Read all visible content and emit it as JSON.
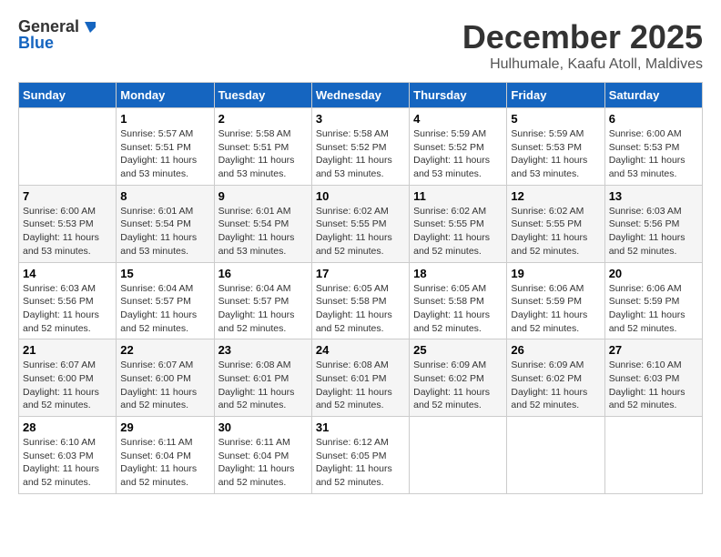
{
  "logo": {
    "line1": "General",
    "line2": "Blue"
  },
  "title": "December 2025",
  "location": "Hulhumale, Kaafu Atoll, Maldives",
  "days_of_week": [
    "Sunday",
    "Monday",
    "Tuesday",
    "Wednesday",
    "Thursday",
    "Friday",
    "Saturday"
  ],
  "weeks": [
    [
      {
        "day": "",
        "info": ""
      },
      {
        "day": "1",
        "info": "Sunrise: 5:57 AM\nSunset: 5:51 PM\nDaylight: 11 hours\nand 53 minutes."
      },
      {
        "day": "2",
        "info": "Sunrise: 5:58 AM\nSunset: 5:51 PM\nDaylight: 11 hours\nand 53 minutes."
      },
      {
        "day": "3",
        "info": "Sunrise: 5:58 AM\nSunset: 5:52 PM\nDaylight: 11 hours\nand 53 minutes."
      },
      {
        "day": "4",
        "info": "Sunrise: 5:59 AM\nSunset: 5:52 PM\nDaylight: 11 hours\nand 53 minutes."
      },
      {
        "day": "5",
        "info": "Sunrise: 5:59 AM\nSunset: 5:53 PM\nDaylight: 11 hours\nand 53 minutes."
      },
      {
        "day": "6",
        "info": "Sunrise: 6:00 AM\nSunset: 5:53 PM\nDaylight: 11 hours\nand 53 minutes."
      }
    ],
    [
      {
        "day": "7",
        "info": "Sunrise: 6:00 AM\nSunset: 5:53 PM\nDaylight: 11 hours\nand 53 minutes."
      },
      {
        "day": "8",
        "info": "Sunrise: 6:01 AM\nSunset: 5:54 PM\nDaylight: 11 hours\nand 53 minutes."
      },
      {
        "day": "9",
        "info": "Sunrise: 6:01 AM\nSunset: 5:54 PM\nDaylight: 11 hours\nand 53 minutes."
      },
      {
        "day": "10",
        "info": "Sunrise: 6:02 AM\nSunset: 5:55 PM\nDaylight: 11 hours\nand 52 minutes."
      },
      {
        "day": "11",
        "info": "Sunrise: 6:02 AM\nSunset: 5:55 PM\nDaylight: 11 hours\nand 52 minutes."
      },
      {
        "day": "12",
        "info": "Sunrise: 6:02 AM\nSunset: 5:55 PM\nDaylight: 11 hours\nand 52 minutes."
      },
      {
        "day": "13",
        "info": "Sunrise: 6:03 AM\nSunset: 5:56 PM\nDaylight: 11 hours\nand 52 minutes."
      }
    ],
    [
      {
        "day": "14",
        "info": "Sunrise: 6:03 AM\nSunset: 5:56 PM\nDaylight: 11 hours\nand 52 minutes."
      },
      {
        "day": "15",
        "info": "Sunrise: 6:04 AM\nSunset: 5:57 PM\nDaylight: 11 hours\nand 52 minutes."
      },
      {
        "day": "16",
        "info": "Sunrise: 6:04 AM\nSunset: 5:57 PM\nDaylight: 11 hours\nand 52 minutes."
      },
      {
        "day": "17",
        "info": "Sunrise: 6:05 AM\nSunset: 5:58 PM\nDaylight: 11 hours\nand 52 minutes."
      },
      {
        "day": "18",
        "info": "Sunrise: 6:05 AM\nSunset: 5:58 PM\nDaylight: 11 hours\nand 52 minutes."
      },
      {
        "day": "19",
        "info": "Sunrise: 6:06 AM\nSunset: 5:59 PM\nDaylight: 11 hours\nand 52 minutes."
      },
      {
        "day": "20",
        "info": "Sunrise: 6:06 AM\nSunset: 5:59 PM\nDaylight: 11 hours\nand 52 minutes."
      }
    ],
    [
      {
        "day": "21",
        "info": "Sunrise: 6:07 AM\nSunset: 6:00 PM\nDaylight: 11 hours\nand 52 minutes."
      },
      {
        "day": "22",
        "info": "Sunrise: 6:07 AM\nSunset: 6:00 PM\nDaylight: 11 hours\nand 52 minutes."
      },
      {
        "day": "23",
        "info": "Sunrise: 6:08 AM\nSunset: 6:01 PM\nDaylight: 11 hours\nand 52 minutes."
      },
      {
        "day": "24",
        "info": "Sunrise: 6:08 AM\nSunset: 6:01 PM\nDaylight: 11 hours\nand 52 minutes."
      },
      {
        "day": "25",
        "info": "Sunrise: 6:09 AM\nSunset: 6:02 PM\nDaylight: 11 hours\nand 52 minutes."
      },
      {
        "day": "26",
        "info": "Sunrise: 6:09 AM\nSunset: 6:02 PM\nDaylight: 11 hours\nand 52 minutes."
      },
      {
        "day": "27",
        "info": "Sunrise: 6:10 AM\nSunset: 6:03 PM\nDaylight: 11 hours\nand 52 minutes."
      }
    ],
    [
      {
        "day": "28",
        "info": "Sunrise: 6:10 AM\nSunset: 6:03 PM\nDaylight: 11 hours\nand 52 minutes."
      },
      {
        "day": "29",
        "info": "Sunrise: 6:11 AM\nSunset: 6:04 PM\nDaylight: 11 hours\nand 52 minutes."
      },
      {
        "day": "30",
        "info": "Sunrise: 6:11 AM\nSunset: 6:04 PM\nDaylight: 11 hours\nand 52 minutes."
      },
      {
        "day": "31",
        "info": "Sunrise: 6:12 AM\nSunset: 6:05 PM\nDaylight: 11 hours\nand 52 minutes."
      },
      {
        "day": "",
        "info": ""
      },
      {
        "day": "",
        "info": ""
      },
      {
        "day": "",
        "info": ""
      }
    ]
  ]
}
